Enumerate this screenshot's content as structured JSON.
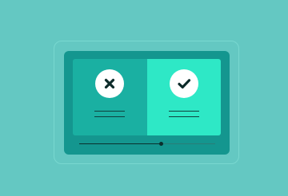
{
  "colors": {
    "background": "#64c8c2",
    "device": "#14968f",
    "reject_panel": "#1ab0a2",
    "accept_panel": "#2ee8c6",
    "icon_circle": "#ffffff",
    "ink": "#0f3f3c"
  },
  "options": [
    {
      "id": "reject",
      "icon": "close-icon"
    },
    {
      "id": "accept",
      "icon": "checkmark-icon"
    }
  ],
  "progress": {
    "value": 0.6
  }
}
